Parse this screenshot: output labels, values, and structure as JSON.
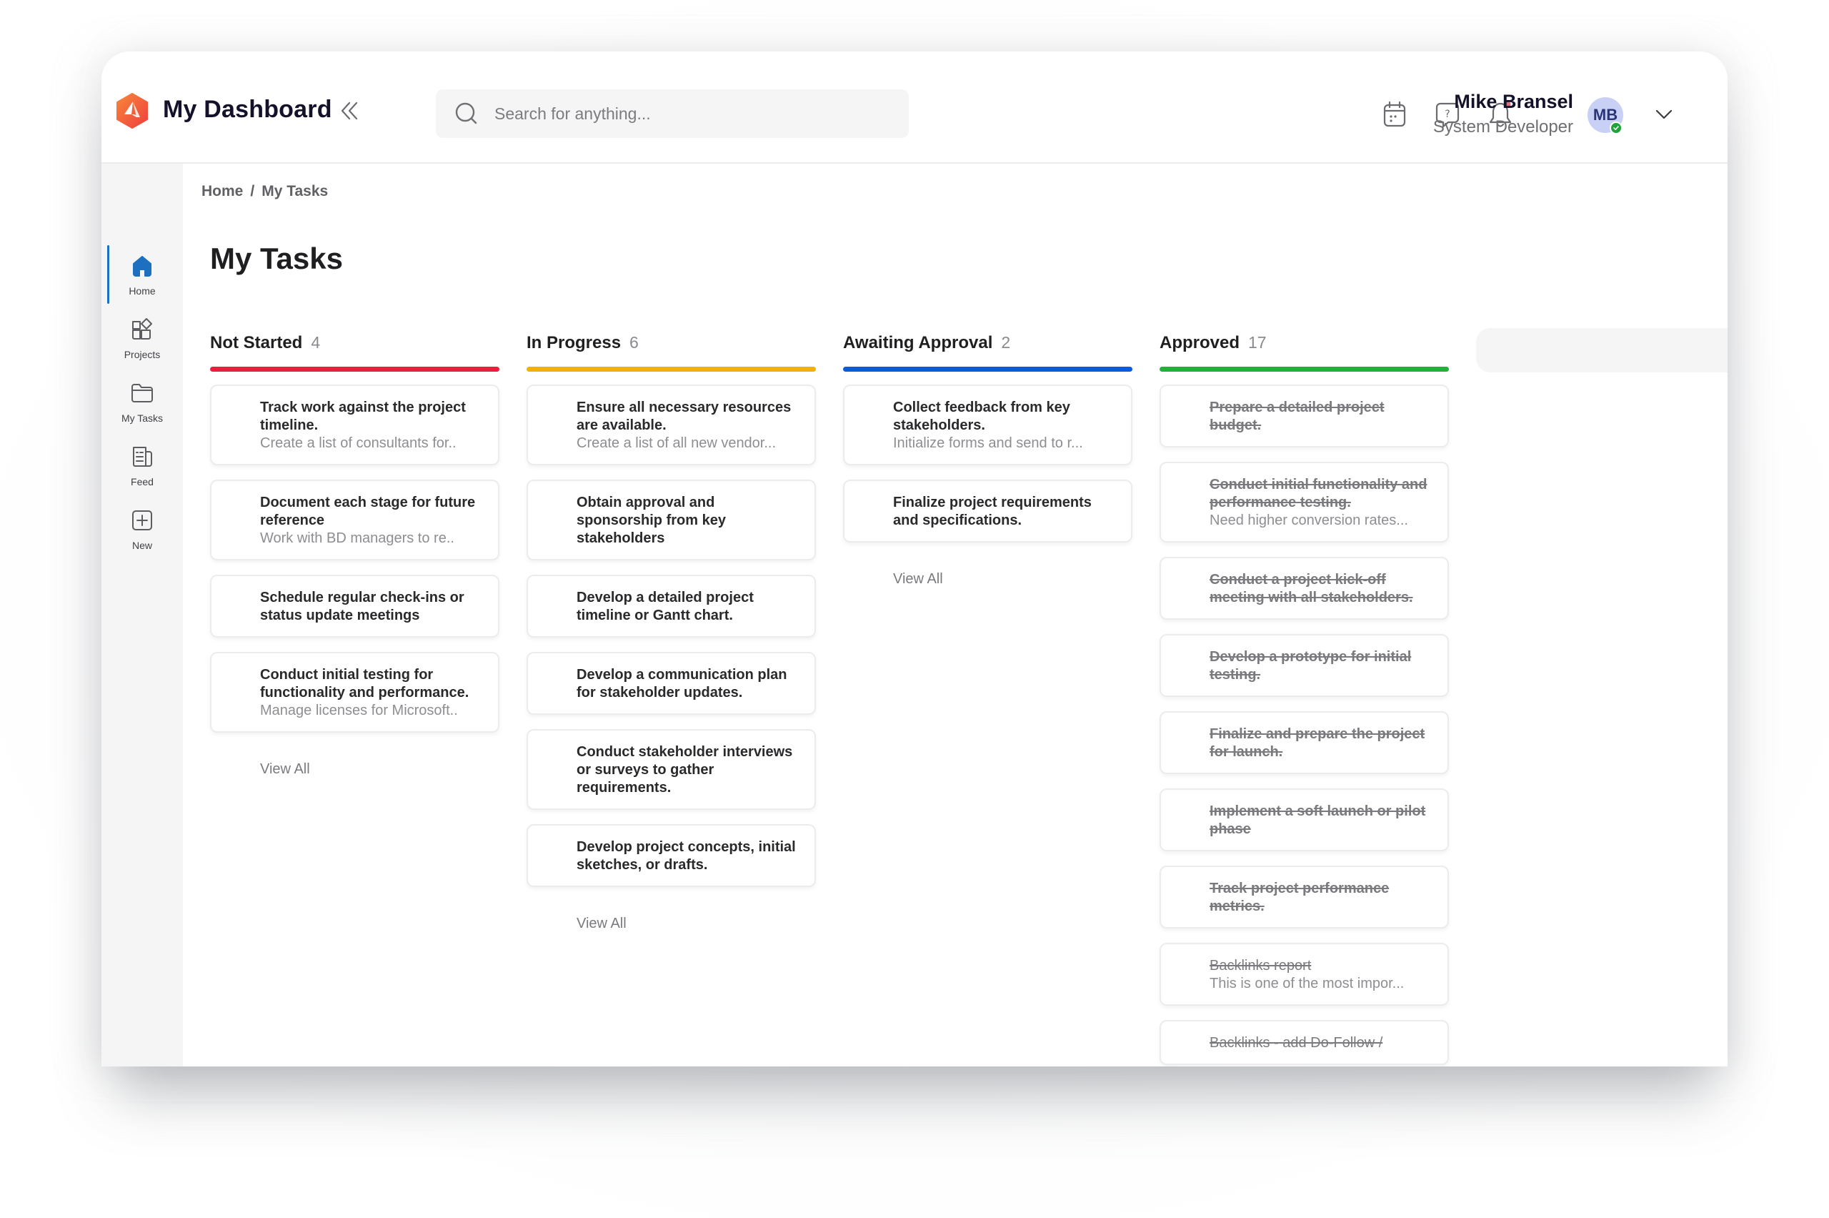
{
  "app": {
    "title": "My Dashboard",
    "brand_color": "#f05a3a"
  },
  "header": {
    "search_placeholder": "Search for anything...",
    "search_value": "",
    "icons": [
      "calendar-icon",
      "help-chat-icon",
      "bell-icon"
    ],
    "notification_dot_color": "#e56b7b",
    "user": {
      "name": "Mike Bransel",
      "role": "System Developer",
      "initials": "MB",
      "status": "online"
    }
  },
  "sidebar": {
    "items": [
      {
        "label": "Home",
        "icon": "home-icon",
        "active": true
      },
      {
        "label": "Projects",
        "icon": "projects-icon",
        "active": false
      },
      {
        "label": "My Tasks",
        "icon": "folder-icon",
        "active": false
      },
      {
        "label": "Feed",
        "icon": "feed-icon",
        "active": false
      },
      {
        "label": "New",
        "icon": "plus-square-icon",
        "active": false
      }
    ]
  },
  "breadcrumb": {
    "items": [
      "Home",
      "My Tasks"
    ],
    "separator": "/"
  },
  "page": {
    "title": "My Tasks"
  },
  "columns": [
    {
      "title": "Not Started",
      "count": "4",
      "color": "#e8203e",
      "view_all": "View All",
      "cards": [
        {
          "title": "Track work against the project timeline.",
          "subtitle": "Create a list of consultants for.."
        },
        {
          "title": "Document each stage for future reference",
          "subtitle": "Work with BD managers to re.."
        },
        {
          "title": "Schedule regular check-ins or status update meetings",
          "subtitle": ""
        },
        {
          "title": "Conduct initial testing for functionality and performance.",
          "subtitle": "Manage licenses for Microsoft.."
        }
      ]
    },
    {
      "title": "In Progress",
      "count": "6",
      "color": "#f0b10c",
      "view_all": "View All",
      "cards": [
        {
          "title": "Ensure all necessary resources are available.",
          "subtitle": "Create a list of all new vendor..."
        },
        {
          "title": "Obtain approval and sponsorship from key stakeholders",
          "subtitle": ""
        },
        {
          "title": "Develop a detailed project timeline or Gantt chart.",
          "subtitle": ""
        },
        {
          "title": "Develop a communication plan for stakeholder updates.",
          "subtitle": ""
        },
        {
          "title": "Conduct stakeholder interviews or surveys to gather requirements.",
          "subtitle": ""
        },
        {
          "title": "Develop project concepts, initial sketches, or drafts.",
          "subtitle": ""
        }
      ]
    },
    {
      "title": "Awaiting Approval",
      "count": "2",
      "color": "#0d5bdc",
      "view_all": "View All",
      "cards": [
        {
          "title": "Collect feedback from key stakeholders.",
          "subtitle": "Initialize forms and send to r..."
        },
        {
          "title": "Finalize project requirements and specifications.",
          "subtitle": ""
        }
      ]
    },
    {
      "title": "Approved",
      "count": "17",
      "color": "#22b03b",
      "view_all": "",
      "cards": [
        {
          "title": "Prepare a detailed project budget.",
          "subtitle": "",
          "done": true
        },
        {
          "title": "Conduct initial functionality and performance testing.",
          "subtitle": "Need higher conversion rates...",
          "done": true
        },
        {
          "title": "Conduct a project kick-off meeting with all stakeholders.",
          "subtitle": "",
          "done": true
        },
        {
          "title": "Develop a prototype for initial testing.",
          "subtitle": "",
          "done": true
        },
        {
          "title": "Finalize and prepare the project for launch.",
          "subtitle": "",
          "done": true
        },
        {
          "title": "Implement a soft launch or pilot phase",
          "subtitle": "",
          "done": true
        },
        {
          "title": "Track project performance metrics.",
          "subtitle": "",
          "done": true
        },
        {
          "title": "Backlinks report",
          "subtitle": "This is one of the most impor...",
          "done": true,
          "light": true
        },
        {
          "title": "Backlinks - add Do-Follow /",
          "subtitle": "",
          "done": true,
          "light": true
        }
      ]
    }
  ]
}
